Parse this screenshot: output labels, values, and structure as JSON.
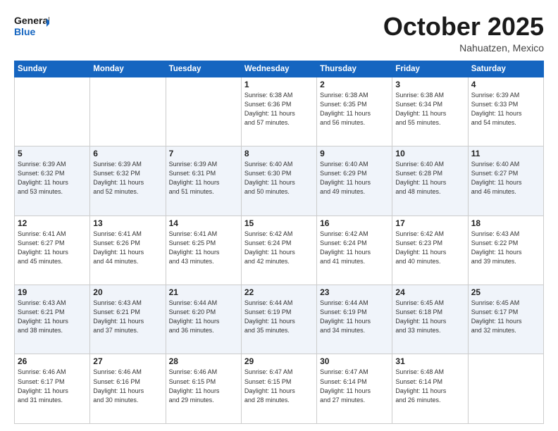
{
  "header": {
    "logo_line1": "General",
    "logo_line2": "Blue",
    "month": "October 2025",
    "location": "Nahuatzen, Mexico"
  },
  "days_of_week": [
    "Sunday",
    "Monday",
    "Tuesday",
    "Wednesday",
    "Thursday",
    "Friday",
    "Saturday"
  ],
  "weeks": [
    [
      {
        "day": "",
        "info": ""
      },
      {
        "day": "",
        "info": ""
      },
      {
        "day": "",
        "info": ""
      },
      {
        "day": "1",
        "info": "Sunrise: 6:38 AM\nSunset: 6:36 PM\nDaylight: 11 hours\nand 57 minutes."
      },
      {
        "day": "2",
        "info": "Sunrise: 6:38 AM\nSunset: 6:35 PM\nDaylight: 11 hours\nand 56 minutes."
      },
      {
        "day": "3",
        "info": "Sunrise: 6:38 AM\nSunset: 6:34 PM\nDaylight: 11 hours\nand 55 minutes."
      },
      {
        "day": "4",
        "info": "Sunrise: 6:39 AM\nSunset: 6:33 PM\nDaylight: 11 hours\nand 54 minutes."
      }
    ],
    [
      {
        "day": "5",
        "info": "Sunrise: 6:39 AM\nSunset: 6:32 PM\nDaylight: 11 hours\nand 53 minutes."
      },
      {
        "day": "6",
        "info": "Sunrise: 6:39 AM\nSunset: 6:32 PM\nDaylight: 11 hours\nand 52 minutes."
      },
      {
        "day": "7",
        "info": "Sunrise: 6:39 AM\nSunset: 6:31 PM\nDaylight: 11 hours\nand 51 minutes."
      },
      {
        "day": "8",
        "info": "Sunrise: 6:40 AM\nSunset: 6:30 PM\nDaylight: 11 hours\nand 50 minutes."
      },
      {
        "day": "9",
        "info": "Sunrise: 6:40 AM\nSunset: 6:29 PM\nDaylight: 11 hours\nand 49 minutes."
      },
      {
        "day": "10",
        "info": "Sunrise: 6:40 AM\nSunset: 6:28 PM\nDaylight: 11 hours\nand 48 minutes."
      },
      {
        "day": "11",
        "info": "Sunrise: 6:40 AM\nSunset: 6:27 PM\nDaylight: 11 hours\nand 46 minutes."
      }
    ],
    [
      {
        "day": "12",
        "info": "Sunrise: 6:41 AM\nSunset: 6:27 PM\nDaylight: 11 hours\nand 45 minutes."
      },
      {
        "day": "13",
        "info": "Sunrise: 6:41 AM\nSunset: 6:26 PM\nDaylight: 11 hours\nand 44 minutes."
      },
      {
        "day": "14",
        "info": "Sunrise: 6:41 AM\nSunset: 6:25 PM\nDaylight: 11 hours\nand 43 minutes."
      },
      {
        "day": "15",
        "info": "Sunrise: 6:42 AM\nSunset: 6:24 PM\nDaylight: 11 hours\nand 42 minutes."
      },
      {
        "day": "16",
        "info": "Sunrise: 6:42 AM\nSunset: 6:24 PM\nDaylight: 11 hours\nand 41 minutes."
      },
      {
        "day": "17",
        "info": "Sunrise: 6:42 AM\nSunset: 6:23 PM\nDaylight: 11 hours\nand 40 minutes."
      },
      {
        "day": "18",
        "info": "Sunrise: 6:43 AM\nSunset: 6:22 PM\nDaylight: 11 hours\nand 39 minutes."
      }
    ],
    [
      {
        "day": "19",
        "info": "Sunrise: 6:43 AM\nSunset: 6:21 PM\nDaylight: 11 hours\nand 38 minutes."
      },
      {
        "day": "20",
        "info": "Sunrise: 6:43 AM\nSunset: 6:21 PM\nDaylight: 11 hours\nand 37 minutes."
      },
      {
        "day": "21",
        "info": "Sunrise: 6:44 AM\nSunset: 6:20 PM\nDaylight: 11 hours\nand 36 minutes."
      },
      {
        "day": "22",
        "info": "Sunrise: 6:44 AM\nSunset: 6:19 PM\nDaylight: 11 hours\nand 35 minutes."
      },
      {
        "day": "23",
        "info": "Sunrise: 6:44 AM\nSunset: 6:19 PM\nDaylight: 11 hours\nand 34 minutes."
      },
      {
        "day": "24",
        "info": "Sunrise: 6:45 AM\nSunset: 6:18 PM\nDaylight: 11 hours\nand 33 minutes."
      },
      {
        "day": "25",
        "info": "Sunrise: 6:45 AM\nSunset: 6:17 PM\nDaylight: 11 hours\nand 32 minutes."
      }
    ],
    [
      {
        "day": "26",
        "info": "Sunrise: 6:46 AM\nSunset: 6:17 PM\nDaylight: 11 hours\nand 31 minutes."
      },
      {
        "day": "27",
        "info": "Sunrise: 6:46 AM\nSunset: 6:16 PM\nDaylight: 11 hours\nand 30 minutes."
      },
      {
        "day": "28",
        "info": "Sunrise: 6:46 AM\nSunset: 6:15 PM\nDaylight: 11 hours\nand 29 minutes."
      },
      {
        "day": "29",
        "info": "Sunrise: 6:47 AM\nSunset: 6:15 PM\nDaylight: 11 hours\nand 28 minutes."
      },
      {
        "day": "30",
        "info": "Sunrise: 6:47 AM\nSunset: 6:14 PM\nDaylight: 11 hours\nand 27 minutes."
      },
      {
        "day": "31",
        "info": "Sunrise: 6:48 AM\nSunset: 6:14 PM\nDaylight: 11 hours\nand 26 minutes."
      },
      {
        "day": "",
        "info": ""
      }
    ]
  ]
}
